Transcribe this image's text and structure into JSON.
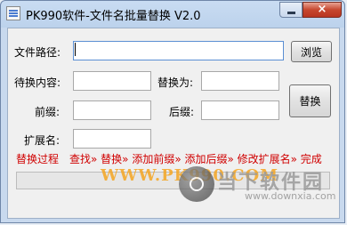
{
  "window": {
    "title": "PK990软件-文件名批量替换 V2.0",
    "close_glyph": "×"
  },
  "form": {
    "path_label": "文件路径:",
    "path_value": "",
    "browse_label": "浏览",
    "find_label": "待换内容:",
    "find_value": "",
    "replace_label": "替换为:",
    "replace_value": "",
    "prefix_label": "前缀:",
    "prefix_value": "",
    "suffix_label": "后缀:",
    "suffix_value": "",
    "ext_label": "扩展名:",
    "ext_value": "",
    "replace_button": "替换"
  },
  "status": {
    "title": "替换过程",
    "steps": "查找» 替换» 添加前缀» 添加后缀» 修改扩展名» 完成"
  },
  "progress": {
    "fraction": 0,
    "fill_color": "#37b24d"
  },
  "watermark": {
    "url": "WWW.PK990.COM",
    "brand": "当下软件园",
    "domain": "www.downxia.com"
  }
}
